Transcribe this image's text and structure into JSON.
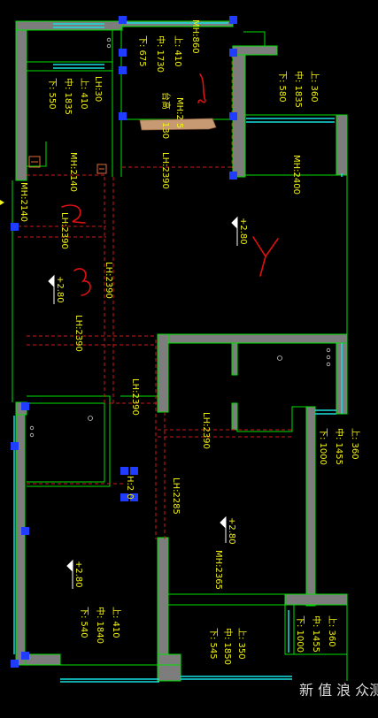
{
  "plan": {
    "colors": {
      "background": "#000000",
      "wall_outline": "#00e000",
      "wall_fill": "#7d7d7d",
      "window": "#19e0e0",
      "dimension_lines": "#d01818",
      "labels": "#f2f21a",
      "grips": "#1f3cff",
      "hand_annotation": "#e01010",
      "stone_hatch": "#c89a74"
    },
    "labels": {
      "mh_860": "MH:860",
      "top_window_top": "上: 410",
      "top_window_mid": "中: 1730",
      "top_window_bot": "下: 675",
      "lh_30": "LH:30",
      "bedroom1_top": "上: 410",
      "bedroom1_mid": "中: 1835",
      "bedroom1_bot": "下: 550",
      "platform": "台高",
      "mh_2x": "MH:2  5",
      "h_130": "130",
      "right_window_top": "上: 360",
      "right_window_mid": "中: 1835",
      "right_window_bot": "下: 580",
      "mh_2140_a": "MH:2140",
      "lh_2390_a": "LH:2390",
      "mh_2400": "MH:2400",
      "mh_2140_b": "MH:2140",
      "lh_2390_b": "LH:2390",
      "elev_280_living": "+2.80",
      "lh_2390_c": "LH:2390",
      "elev_280_left": "+2.80",
      "lh_2390_d": "LH:2390",
      "lh_2390_e": "LH:2390",
      "lh_2390_f": "LH:2390",
      "mid_window_top": "上: 360",
      "mid_window_mid": "中: 1455",
      "mid_window_bot": "下: 1000",
      "h_2_0": "H:2  0",
      "lh_2285": "LH:2285",
      "elev_280_center": "+2.80",
      "mh_2365": "MH:2365",
      "elev_280_bedroom": "+2.80",
      "bedroom_bl_top": "上: 410",
      "bedroom_bl_mid": "中: 1840",
      "bedroom_bl_bot": "下: 540",
      "bottom_window_top": "上: 350",
      "bottom_window_mid": "中: 1850",
      "bottom_window_bot": "下: 545",
      "br_window_top": "上: 360",
      "br_window_mid": "中: 1455",
      "br_window_bot": "下: 1000"
    },
    "hand_marks": {
      "mark_2": "2",
      "mark_3": "3",
      "mark_4": "4"
    },
    "watermark": "新 值 浪 众测"
  }
}
